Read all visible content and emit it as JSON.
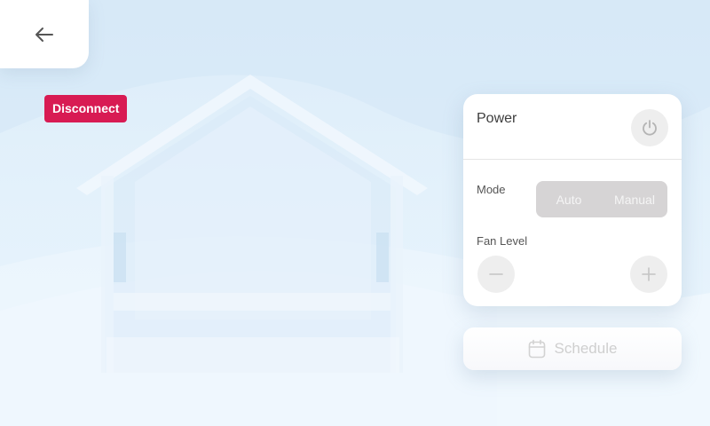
{
  "navigation": {
    "back_icon": "arrow-left-icon"
  },
  "connection": {
    "disconnect_label": "Disconnect",
    "disconnect_color": "#d81b53"
  },
  "control_panel": {
    "power": {
      "label": "Power",
      "icon": "power-icon"
    },
    "mode": {
      "label": "Mode",
      "options": [
        "Auto",
        "Manual"
      ]
    },
    "fan_level": {
      "label": "Fan Level",
      "decrease_icon": "minus-icon",
      "increase_icon": "plus-icon"
    }
  },
  "schedule": {
    "label": "Schedule",
    "icon": "calendar-icon"
  }
}
